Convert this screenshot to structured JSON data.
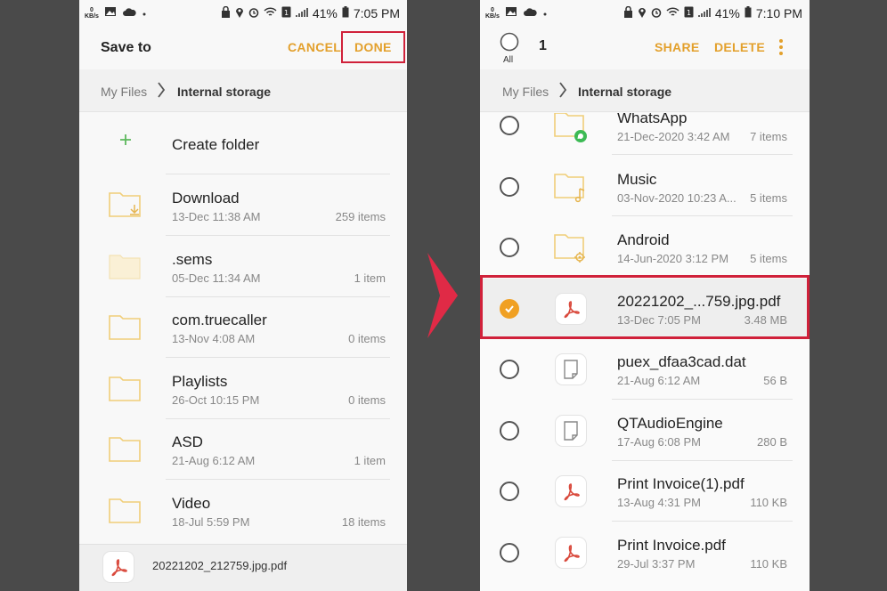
{
  "colors": {
    "accent": "#e3a02c",
    "highlight": "#d0213a",
    "folder": "#f4d37d",
    "pdf": "#d9493c"
  },
  "left_screen": {
    "status": {
      "kbs": "0",
      "kbs_unit": "KB/s",
      "battery": "41%",
      "time": "7:05 PM"
    },
    "header": {
      "title": "Save to",
      "cancel": "CANCEL",
      "done": "DONE"
    },
    "breadcrumb": {
      "root": "My Files",
      "current": "Internal storage"
    },
    "create_folder": "Create folder",
    "folders": [
      {
        "name": "Download",
        "date": "13-Dec 11:38 AM",
        "count": "259 items",
        "icon": "download-folder-icon"
      },
      {
        "name": ".sems",
        "date": "05-Dec 11:34 AM",
        "count": "1 item",
        "icon": "hidden-folder-icon"
      },
      {
        "name": "com.truecaller",
        "date": "13-Nov 4:08 AM",
        "count": "0 items",
        "icon": "folder-icon"
      },
      {
        "name": "Playlists",
        "date": "26-Oct 10:15 PM",
        "count": "0 items",
        "icon": "folder-icon"
      },
      {
        "name": "ASD",
        "date": "21-Aug 6:12 AM",
        "count": "1 item",
        "icon": "folder-icon"
      },
      {
        "name": "Video",
        "date": "18-Jul 5:59 PM",
        "count": "18 items",
        "icon": "folder-icon"
      }
    ],
    "bottom_file": "20221202_212759.jpg.pdf"
  },
  "right_screen": {
    "status": {
      "kbs": "0",
      "kbs_unit": "KB/s",
      "battery": "41%",
      "time": "7:10 PM"
    },
    "header": {
      "all_label": "All",
      "selected_count": "1",
      "share": "SHARE",
      "delete": "DELETE"
    },
    "breadcrumb": {
      "root": "My Files",
      "current": "Internal storage"
    },
    "items": [
      {
        "name": "WhatsApp",
        "date": "21-Dec-2020 3:42 AM",
        "count": "7 items",
        "icon": "whatsapp-folder-icon",
        "checked": false
      },
      {
        "name": "Music",
        "date": "03-Nov-2020 10:23 A...",
        "count": "5 items",
        "icon": "music-folder-icon",
        "checked": false
      },
      {
        "name": "Android",
        "date": "14-Jun-2020 3:12 PM",
        "count": "5 items",
        "icon": "settings-folder-icon",
        "checked": false
      },
      {
        "name": "20221202_...759.jpg.pdf",
        "date": "13-Dec 7:05 PM",
        "count": "3.48 MB",
        "icon": "pdf-icon",
        "checked": true
      },
      {
        "name": "puex_dfaa3cad.dat",
        "date": "21-Aug 6:12 AM",
        "count": "56 B",
        "icon": "file-icon",
        "checked": false
      },
      {
        "name": "QTAudioEngine",
        "date": "17-Aug 6:08 PM",
        "count": "280 B",
        "icon": "file-icon",
        "checked": false
      },
      {
        "name": "Print Invoice(1).pdf",
        "date": "13-Aug 4:31 PM",
        "count": "110 KB",
        "icon": "pdf-icon",
        "checked": false
      },
      {
        "name": "Print Invoice.pdf",
        "date": "29-Jul 3:37 PM",
        "count": "110 KB",
        "icon": "pdf-icon",
        "checked": false
      }
    ]
  }
}
